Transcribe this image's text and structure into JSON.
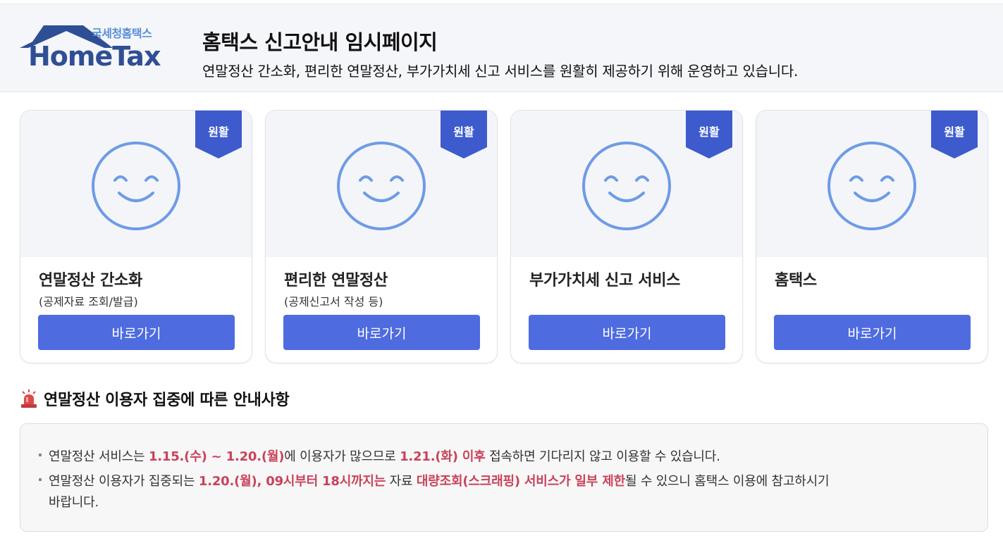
{
  "header": {
    "logo_small": "국세청홈택스",
    "logo_big": "HomeTax",
    "title": "홈택스 신고안내 임시페이지",
    "description": "연말정산 간소화, 편리한 연말정산, 부가가치세 신고 서비스를 원활히 제공하기 위해 운영하고 있습니다."
  },
  "cards": [
    {
      "badge": "원활",
      "title": "연말정산 간소화",
      "subtitle": "(공제자료 조회/발급)",
      "button": "바로가기",
      "icon": "smiley-icon"
    },
    {
      "badge": "원활",
      "title": "편리한 연말정산",
      "subtitle": "(공제신고서 작성 등)",
      "button": "바로가기",
      "icon": "smiley-icon"
    },
    {
      "badge": "원활",
      "title": "부가가치세 신고 서비스",
      "subtitle": "",
      "button": "바로가기",
      "icon": "smiley-icon"
    },
    {
      "badge": "원활",
      "title": "홈택스",
      "subtitle": "",
      "button": "바로가기",
      "icon": "smiley-icon"
    }
  ],
  "notice": {
    "icon": "siren-icon",
    "title": "연말정산 이용자 집중에 따른 안내사항",
    "line1": {
      "t1": "연말정산 서비스는 ",
      "h1": "1.15.(수) ~ 1.20.(월)",
      "t2": "에 이용자가 많으므로 ",
      "h2": "1.21.(화) 이후",
      "t3": " 접속하면 기다리지 않고 이용할 수 있습니다."
    },
    "line2": {
      "t1": "연말정산 이용자가 집중되는 ",
      "h1": "1.20.(월), 09시부터 18시까지는",
      "t2": " 자료 ",
      "h2": "대량조회(스크래핑) 서비스가 일부 제한",
      "t3": "될 수 있으니 홈택스 이용에 참고하시기",
      "t4": "바랍니다."
    }
  },
  "colors": {
    "accent": "#4e6be0",
    "badge": "#3d5bcc",
    "highlight": "#c9425a",
    "smiley": "#6e9be6",
    "logo": "#2f4f95"
  }
}
